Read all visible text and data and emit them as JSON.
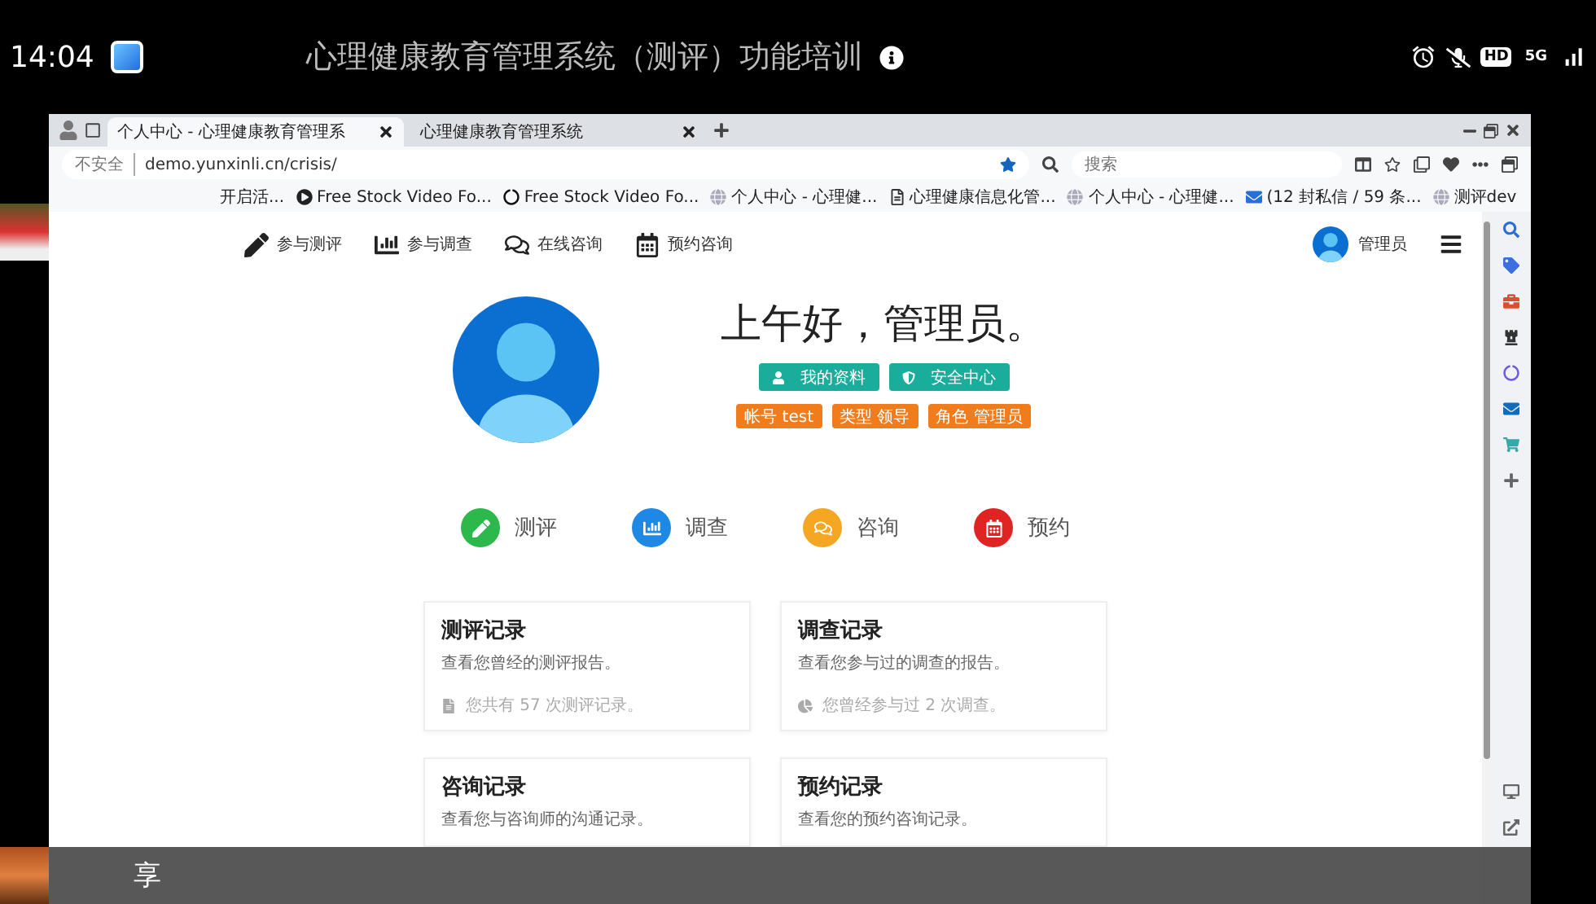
{
  "status_bar": {
    "time": "14:04",
    "badges": [
      {
        "kind": "hd",
        "text": "HD"
      },
      {
        "kind": "network",
        "text": "5G"
      }
    ]
  },
  "meeting": {
    "title": "心理健康教育管理系统（测评）功能培训",
    "caption": "享"
  },
  "browser": {
    "tabs": [
      {
        "title": "个人中心 - 心理健康教育管理系",
        "selected": true
      },
      {
        "title": "心理健康教育管理系统",
        "selected": false
      }
    ],
    "security": "不安全",
    "url": "demo.yunxinli.cn/crisis/",
    "search": {
      "placeholder": "搜索"
    },
    "bookmarks": [
      {
        "kind": "plain",
        "title": "开启活..."
      },
      {
        "kind": "video",
        "title": "Free Stock Video Fo..."
      },
      {
        "kind": "video-dark",
        "title": "Free Stock Video Fo..."
      },
      {
        "kind": "site",
        "title": "个人中心 - 心理健..."
      },
      {
        "kind": "doc",
        "title": "心理健康信息化管..."
      },
      {
        "kind": "site",
        "title": "个人中心 - 心理健..."
      },
      {
        "kind": "mail",
        "title": "(12 封私信 / 59 条..."
      },
      {
        "kind": "site",
        "title": "测评dev"
      }
    ]
  },
  "nav": {
    "items": [
      {
        "kind": "assessment",
        "label": "参与测评"
      },
      {
        "kind": "survey",
        "label": "参与调查"
      },
      {
        "kind": "consult",
        "label": "在线咨询"
      },
      {
        "kind": "booking",
        "label": "预约咨询"
      }
    ],
    "user": "管理员"
  },
  "profile": {
    "greeting": "上午好，管理员。",
    "actions": [
      {
        "kind": "info",
        "label": "我的资料"
      },
      {
        "kind": "security",
        "label": "安全中心"
      }
    ],
    "tags": [
      {
        "label": "帐号",
        "value": "test"
      },
      {
        "label": "类型",
        "value": "领导"
      },
      {
        "label": "角色",
        "value": "管理员"
      }
    ]
  },
  "categories": [
    {
      "kind": "assessment",
      "label": "测评",
      "color": "#2db84c"
    },
    {
      "kind": "survey",
      "label": "调查",
      "color": "#1e88e5"
    },
    {
      "kind": "consult",
      "label": "咨询",
      "color": "#f5a623"
    },
    {
      "kind": "booking",
      "label": "预约",
      "color": "#e02424"
    }
  ],
  "cards": [
    {
      "kind": "file",
      "title": "测评记录",
      "description": "查看您曾经的测评报告。",
      "footer": "您共有 57 次测评记录。"
    },
    {
      "kind": "pie",
      "title": "调查记录",
      "description": "查看您参与过的调查的报告。",
      "footer": "您曾经参与过 2 次调查。"
    },
    {
      "kind": "chat",
      "title": "咨询记录",
      "description": "查看您与咨询师的沟通记录。"
    },
    {
      "kind": "clock",
      "title": "预约记录",
      "description": "查看您的预约咨询记录。"
    }
  ]
}
